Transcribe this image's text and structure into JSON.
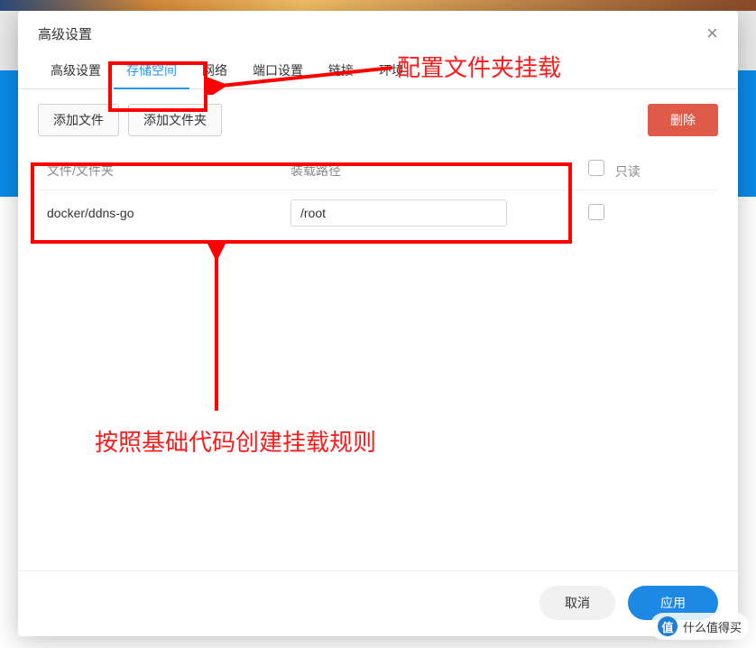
{
  "modal": {
    "title": "高级设置",
    "close_label": "×"
  },
  "tabs": [
    {
      "label": "高级设置",
      "active": false
    },
    {
      "label": "存储空间",
      "active": true
    },
    {
      "label": "网络",
      "active": false
    },
    {
      "label": "端口设置",
      "active": false
    },
    {
      "label": "链接",
      "active": false
    },
    {
      "label": "环境",
      "active": false
    }
  ],
  "toolbar": {
    "add_file": "添加文件",
    "add_folder": "添加文件夹",
    "delete": "删除"
  },
  "table": {
    "col_file": "文件/文件夹",
    "col_path": "装载路径",
    "col_readonly": "只读"
  },
  "row": {
    "file": "docker/ddns-go",
    "path": "/root"
  },
  "footer": {
    "cancel": "取消",
    "apply": "应用"
  },
  "annotations": {
    "top_text": "配置文件夹挂载",
    "bottom_text": "按照基础代码创建挂载规则"
  },
  "watermark": {
    "icon": "值",
    "text": "什么值得买"
  }
}
